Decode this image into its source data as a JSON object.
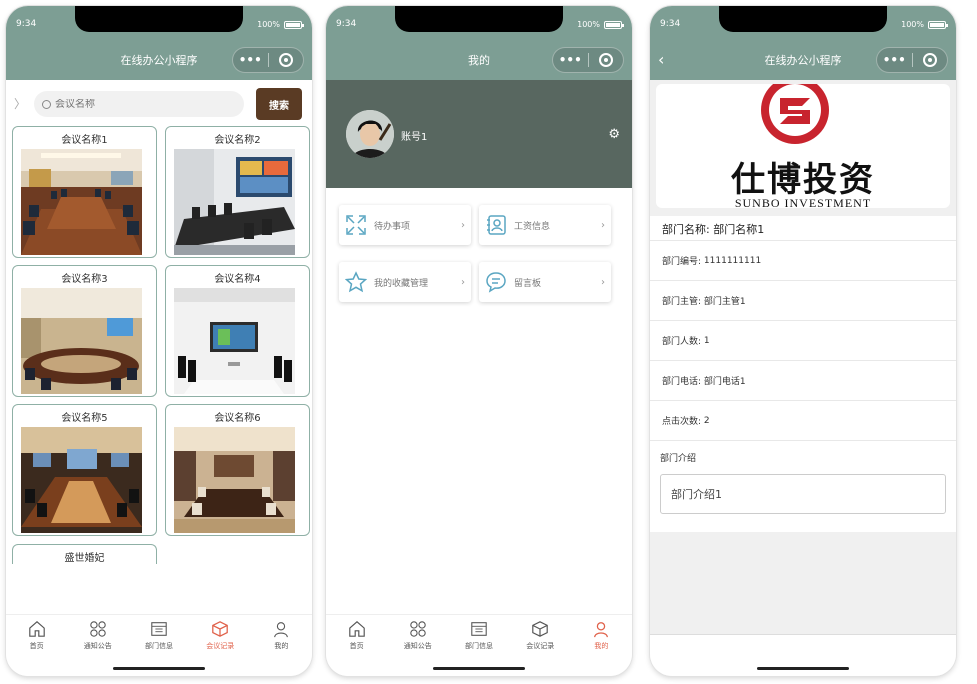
{
  "status": {
    "time": "9:34",
    "battery": "100%"
  },
  "screen1": {
    "title": "在线办公小程序",
    "search": {
      "placeholder": "会议名称",
      "button": "搜索"
    },
    "cards": [
      {
        "name": "会议名称1"
      },
      {
        "name": "会议名称2"
      },
      {
        "name": "会议名称3"
      },
      {
        "name": "会议名称4"
      },
      {
        "name": "会议名称5"
      },
      {
        "name": "会议名称6"
      }
    ],
    "partial_card": "盛世婚妃"
  },
  "tabbar": {
    "items": [
      {
        "label": "首页",
        "icon": "home-icon"
      },
      {
        "label": "通知公告",
        "icon": "grid-icon"
      },
      {
        "label": "部门信息",
        "icon": "calendar-icon"
      },
      {
        "label": "会议记录",
        "icon": "cube-icon"
      },
      {
        "label": "我的",
        "icon": "user-icon"
      }
    ],
    "active_screen1": "会议记录",
    "active_screen2": "我的",
    "active_color": "#e0614a"
  },
  "screen2": {
    "title": "我的",
    "account": "账号1",
    "menu": [
      {
        "label": "待办事项",
        "icon": "expand-icon"
      },
      {
        "label": "工资信息",
        "icon": "contact-card-icon"
      },
      {
        "label": "我的收藏管理",
        "icon": "star-icon"
      },
      {
        "label": "留言板",
        "icon": "chat-icon"
      }
    ]
  },
  "screen3": {
    "title": "在线办公小程序",
    "logo_cn": "仕博投资",
    "logo_en": "SUNBO INVESTMENT",
    "dept_name_label": "部门名称:",
    "dept_name": "部门名称1",
    "rows": [
      {
        "label": "部门编号:",
        "value": "1111111111"
      },
      {
        "label": "部门主管:",
        "value": "部门主管1"
      },
      {
        "label": "部门人数:",
        "value": "1"
      },
      {
        "label": "部门电话:",
        "value": "部门电话1"
      },
      {
        "label": "点击次数:",
        "value": "2"
      }
    ],
    "intro_label": "部门介绍",
    "intro_value": "部门介绍1"
  },
  "colors": {
    "header": "#7d9e94",
    "profile_bg": "#586760",
    "search_button": "#5a3b24",
    "card_border": "#8fb0a6"
  }
}
